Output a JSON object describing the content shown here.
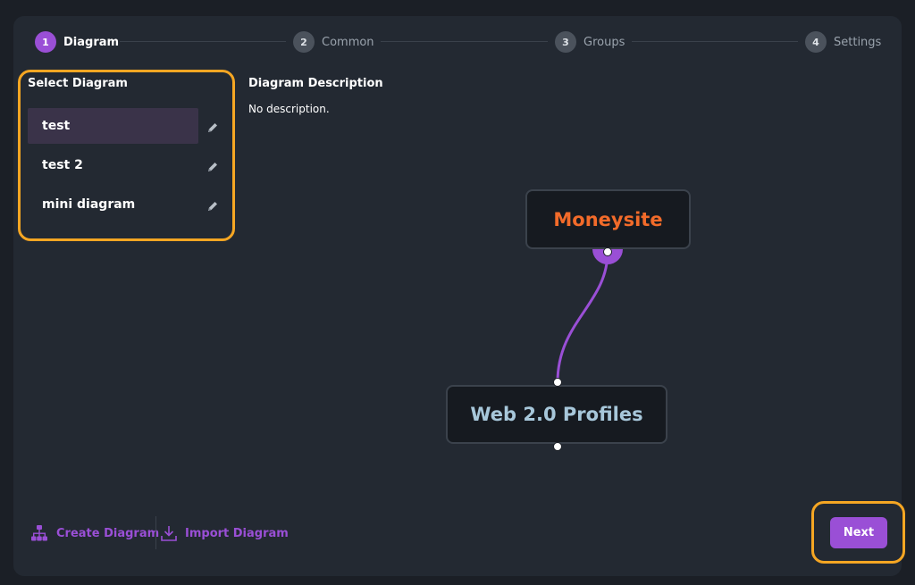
{
  "stepper": {
    "steps": [
      {
        "num": "1",
        "label": "Diagram"
      },
      {
        "num": "2",
        "label": "Common"
      },
      {
        "num": "3",
        "label": "Groups"
      },
      {
        "num": "4",
        "label": "Settings"
      }
    ],
    "active_step": 1
  },
  "left": {
    "title": "Select Diagram",
    "items": [
      {
        "label": "test",
        "selected": true
      },
      {
        "label": "test 2",
        "selected": false
      },
      {
        "label": "mini diagram",
        "selected": false
      }
    ],
    "edit_icon": "pencil-icon"
  },
  "description": {
    "title": "Diagram Description",
    "text": "No description."
  },
  "diagram": {
    "nodes": [
      {
        "label": "Moneysite",
        "color": "#f26b2a"
      },
      {
        "label": "Web 2.0 Profiles",
        "color": "#a7c7da"
      }
    ],
    "edge_color": "#9a4fd6"
  },
  "actions": {
    "create": {
      "label": "Create Diagram",
      "icon": "sitemap-icon"
    },
    "import": {
      "label": "Import Diagram",
      "icon": "download-icon"
    }
  },
  "next_label": "Next",
  "colors": {
    "accent": "#9a4fd6",
    "highlight": "#f5a623",
    "background": "#1b1f26",
    "panel": "#232932"
  }
}
